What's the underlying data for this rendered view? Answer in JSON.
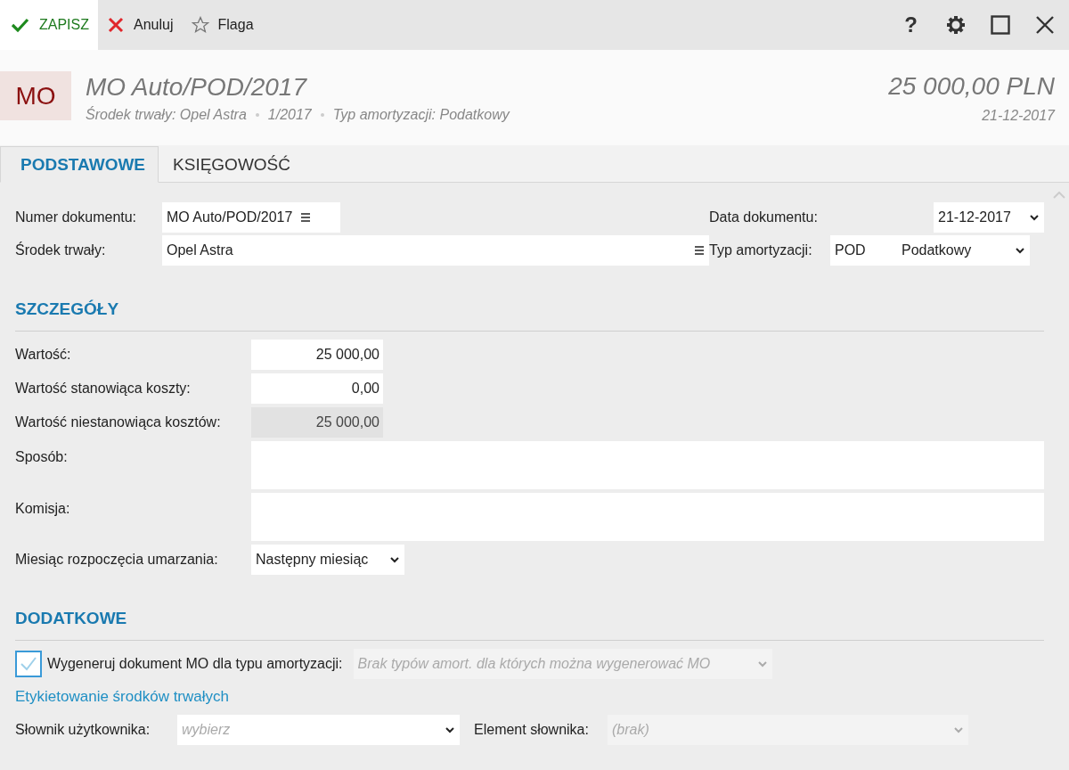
{
  "toolbar": {
    "buttons": [
      {
        "label": "ZAPISZ",
        "kind": "save",
        "selected": true
      },
      {
        "label": "Anuluj",
        "kind": "cancel",
        "selected": false
      },
      {
        "label": "Flaga",
        "kind": "flag",
        "selected": false
      }
    ],
    "window_controls": [
      {
        "kind": "help",
        "glyph": "?"
      },
      {
        "kind": "settings"
      },
      {
        "kind": "maximize"
      },
      {
        "kind": "close"
      }
    ]
  },
  "header": {
    "badge": "MO",
    "title": "MO Auto/POD/2017",
    "subtitle": [
      "Środek trwały: Opel Astra",
      "1/2017",
      "Typ amortyzacji: Podatkowy"
    ],
    "amount": "25 000,00 PLN",
    "date": "21-12-2017"
  },
  "tabs": [
    {
      "label": "PODSTAWOWE",
      "selected": true
    },
    {
      "label": "KSIĘGOWOŚĆ",
      "selected": false
    }
  ],
  "main_fields": [
    {
      "label": "Numer dokumentu:",
      "value": "MO Auto/POD/2017",
      "kind": "lookup"
    },
    {
      "label": "Data dokumentu:",
      "value": "21-12-2017",
      "kind": "dropdown"
    },
    {
      "label": "Środek trwały:",
      "value": "Opel Astra",
      "kind": "lookup"
    },
    {
      "label": "Typ amortyzacji:",
      "value": "POD",
      "value_2": "Podatkowy",
      "kind": "dropdown"
    }
  ],
  "sections": [
    {
      "title": "SZCZEGÓŁY",
      "rows": [
        {
          "label": "Wartość:",
          "value": "25 000,00",
          "kind": "number",
          "disabled": false
        },
        {
          "label": "Wartość stanowiąca koszty:",
          "value": "0,00",
          "kind": "number",
          "disabled": false
        },
        {
          "label": "Wartość niestanowiąca kosztów:",
          "value": "25 000,00",
          "kind": "number",
          "disabled": true
        },
        {
          "label": "Sposób:",
          "kind": "textarea"
        },
        {
          "label": "Komisja:",
          "kind": "textarea"
        },
        {
          "label": "Miesiąc rozpoczęcia umarzania:",
          "value": "Następny miesiąc",
          "kind": "dropdown"
        }
      ]
    },
    {
      "title": "DODATKOWE",
      "checkbox": {
        "label": "Wygeneruj dokument MO dla typu amortyzacji:",
        "checked": true,
        "select_placeholder": "Brak typów amort. dla których można wygenerować MO"
      },
      "link": "Etykietowanie środków trwałych",
      "dictionary": {
        "label": "Słownik użytkownika:",
        "placeholder": "wybierz",
        "element_label": "Element słownika:",
        "element_placeholder": "(brak)"
      }
    }
  ]
}
